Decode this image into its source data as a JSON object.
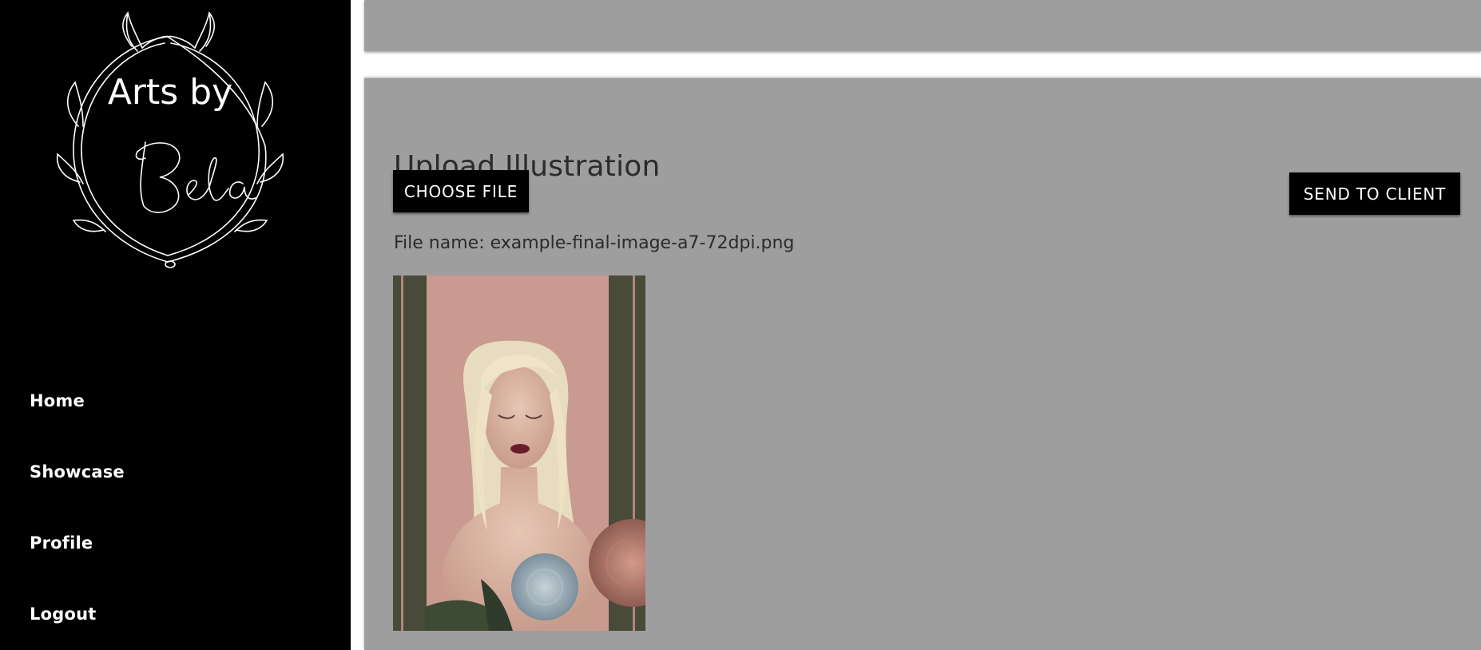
{
  "sidebar": {
    "logo_line1": "Arts by",
    "logo_line2": "Bela",
    "nav": [
      {
        "label": "Home"
      },
      {
        "label": "Showcase"
      },
      {
        "label": "Profile"
      },
      {
        "label": "Logout"
      }
    ]
  },
  "upload": {
    "heading": "Upload Illustration",
    "choose_label": "CHOOSE FILE",
    "send_label": "SEND TO CLIENT",
    "file_name": "File name: example-final-image-a7-72dpi.png"
  },
  "colors": {
    "sidebar_bg": "#000000",
    "card_bg": "#9e9e9e",
    "button_bg": "#000000",
    "button_text": "#ffffff"
  }
}
